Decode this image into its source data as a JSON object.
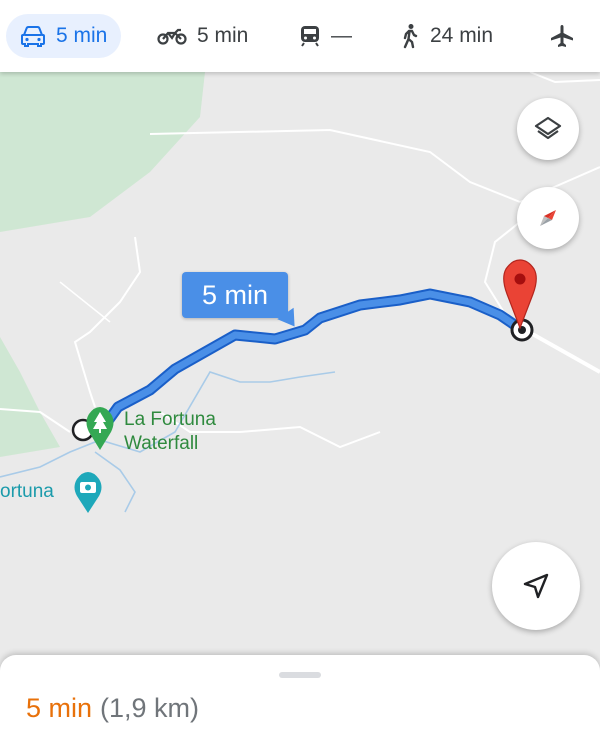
{
  "modes": [
    {
      "icon": "car-icon",
      "label": "5 min",
      "active": true
    },
    {
      "icon": "motorcycle-icon",
      "label": "5 min",
      "active": false
    },
    {
      "icon": "transit-icon",
      "label": "—",
      "active": false
    },
    {
      "icon": "walking-icon",
      "label": "24 min",
      "active": false
    },
    {
      "icon": "flight-icon",
      "label": "",
      "active": false
    }
  ],
  "map": {
    "route_callout": "5 min",
    "poi_waterfall": {
      "line1": "La Fortuna",
      "line2": "Waterfall",
      "icon": "tree-icon"
    },
    "poi_town": {
      "label": "ortuna",
      "icon": "camera-icon"
    },
    "destination_icon": "red-pin-icon"
  },
  "controls": {
    "layers_icon": "layers-icon",
    "compass_icon": "compass-icon",
    "location_icon": "navigation-arrow-icon"
  },
  "sheet": {
    "duration": "5 min",
    "distance": "(1,9 km)"
  },
  "colors": {
    "accent": "#1a73e8",
    "route": "#4a8fe7",
    "duration": "#e8710a",
    "park": "#cfe7d3",
    "pin": "#ea4335"
  }
}
